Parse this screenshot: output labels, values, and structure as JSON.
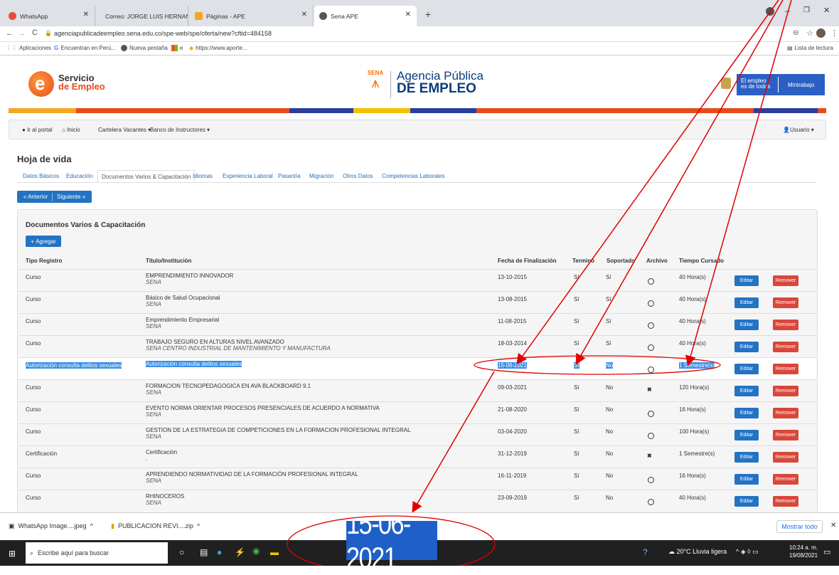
{
  "browser": {
    "tabs": [
      {
        "label": "WhatsApp",
        "color": "#e74c3c"
      },
      {
        "label": "Correo: JORGE LUIS HERNANDEZ",
        "color": "#1e6fc2"
      },
      {
        "label": "Páginas - APE",
        "color": "#f5a623"
      },
      {
        "label": "Sena APE",
        "color": "#555555"
      }
    ],
    "url": "agenciapublicadeempleo.sena.edu.co/spe-web/spe/oferta/new?cftid=484158",
    "bookmarks": [
      "Aplicaciones",
      "Encuentran en Perú...",
      "Nueva pestaña",
      "e",
      "https://www.aporte..."
    ],
    "reading_list": "Lista de lectura"
  },
  "header": {
    "logo_line1": "Servicio",
    "logo_line2": "de Empleo",
    "sena": "SENA",
    "agency_line1": "Agencia Pública",
    "agency_line2": "DE EMPLEO",
    "empleo_line1": "El empleo",
    "empleo_line2": "es de todos",
    "mintrabajo": "Mintrabajo"
  },
  "nav": {
    "portal": "Ir al portal",
    "inicio": "Inicio",
    "cartelera": "Cartelera Vacantes",
    "banco": "Banco de Instructores",
    "usuario": "Usuario"
  },
  "page": {
    "title": "Hoja de vida",
    "tabs": [
      "Datos Básicos",
      "Educación",
      "Documentos Varios & Capacitación",
      "Idiomas",
      "Experiencia Laboral",
      "Pasantía",
      "Migración",
      "Otros Datos",
      "Competencias Laborales"
    ],
    "prev": "Anterior",
    "next": "Siguiente",
    "panel_title": "Documentos Varios & Capacitación",
    "add": "Agregar",
    "columns": [
      "Tipo Registro",
      "Título/Institución",
      "Fecha de Finalización",
      "Terminó",
      "Soportado",
      "Archivo",
      "Tiempo Cursado"
    ],
    "edit_label": "Editar",
    "remove_label": "Remover"
  },
  "rows": [
    {
      "tipo": "Curso",
      "titulo": "EMPRENDIMIENTO INNOVADOR",
      "inst": "SENA",
      "fecha": "13-10-2015",
      "termino": "Sí",
      "soportado": "Sí",
      "archivo": "file",
      "tiempo": "40 Hora(s)"
    },
    {
      "tipo": "Curso",
      "titulo": "Básico de Salud Ocupacional",
      "inst": "SENA",
      "fecha": "13-08-2015",
      "termino": "Sí",
      "soportado": "Sí",
      "archivo": "file",
      "tiempo": "40 Hora(s)"
    },
    {
      "tipo": "Curso",
      "titulo": "Emprendimiento Empresarial",
      "inst": "SENA",
      "fecha": "11-08-2015",
      "termino": "Sí",
      "soportado": "Sí",
      "archivo": "file",
      "tiempo": "40 Hora(s)"
    },
    {
      "tipo": "Curso",
      "titulo": "TRABAJO SEGURO EN ALTURAS NIVEL AVANZADO",
      "inst": "SENA CENTRO INDUSTRIAL DE MANTENIMIENTO Y MANUFACTURA",
      "fecha": "18-03-2014",
      "termino": "Sí",
      "soportado": "Sí",
      "archivo": "file",
      "tiempo": "40 Hora(s)"
    },
    {
      "tipo": "Autorización consulta delitos sexuales",
      "titulo": "Autorización consulta delitos sexuales",
      "inst": "",
      "fecha": "15-06-2021",
      "termino": "Sí",
      "soportado": "No",
      "archivo": "file",
      "tiempo": "1 Semestre(s)",
      "selected": true
    },
    {
      "tipo": "Curso",
      "titulo": "FORMACION TECNOPEDAGOGICA EN AVA BLACKBOARD 9.1",
      "inst": "SENA",
      "fecha": "09-03-2021",
      "termino": "Sí",
      "soportado": "No",
      "archivo": "none",
      "tiempo": "120 Hora(s)"
    },
    {
      "tipo": "Curso",
      "titulo": "EVENTO NORMA ORIENTAR PROCESOS PRESENCIALES DE ACUERDO A NORMATIVA",
      "inst": "SENA",
      "fecha": "21-08-2020",
      "termino": "Sí",
      "soportado": "No",
      "archivo": "file",
      "tiempo": "16 Hora(s)"
    },
    {
      "tipo": "Curso",
      "titulo": "GESTION DE LA ESTRATEGIA DE COMPETICIONES EN LA FORMACION PROFESIONAL INTEGRAL",
      "inst": "SENA",
      "fecha": "03-04-2020",
      "termino": "Sí",
      "soportado": "No",
      "archivo": "file",
      "tiempo": "100 Hora(s)"
    },
    {
      "tipo": "Certificación",
      "titulo": "Certificación",
      "inst": ".",
      "fecha": "31-12-2019",
      "termino": "Sí",
      "soportado": "No",
      "archivo": "none",
      "tiempo": "1 Semestre(s)"
    },
    {
      "tipo": "Curso",
      "titulo": "APRENDIENDO NORMATIVIDAD DE LA FORMACIÓN PROFESIONAL INTEGRAL",
      "inst": "SENA",
      "fecha": "16-11-2019",
      "termino": "Sí",
      "soportado": "No",
      "archivo": "file",
      "tiempo": "16 Hora(s)"
    },
    {
      "tipo": "Curso",
      "titulo": "RHINOCEROS",
      "inst": "SENA",
      "fecha": "23-09-2019",
      "termino": "Sí",
      "soportado": "No",
      "archivo": "file",
      "tiempo": "40 Hora(s)"
    }
  ],
  "downloads": {
    "items": [
      "WhatsApp Image....jpeg",
      "PUBLICACION REVI....zip"
    ],
    "show_all": "Mostrar todo"
  },
  "taskbar": {
    "search": "Escribe aquí para buscar",
    "weather": "20°C Lluvia ligera",
    "time": "10:24 a. m.",
    "date": "19/08/2021"
  },
  "zoom_text": "15-06-2021"
}
